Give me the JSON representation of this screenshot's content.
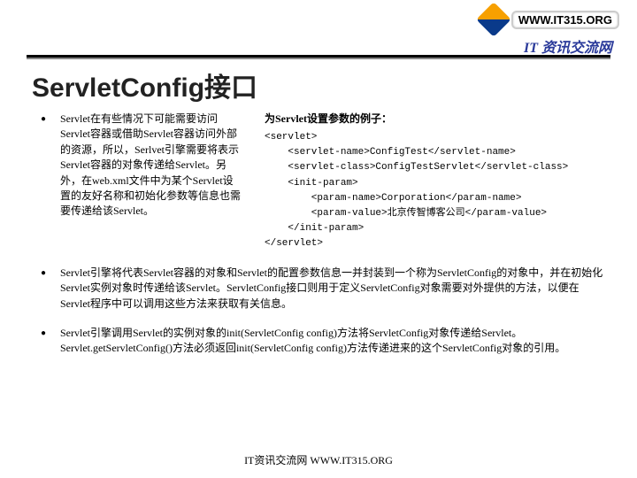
{
  "header": {
    "url": "WWW.IT315.ORG",
    "tagline": "IT 资讯交流网"
  },
  "title": "ServletConfig接口",
  "bullets": {
    "intro": "Servlet在有些情况下可能需要访问Servlet容器或借助Servlet容器访问外部的资源，所以，Serlvet引擎需要将表示Servlet容器的对象传递给Servlet。另外，在web.xml文件中为某个Servlet设置的友好名称和初始化参数等信息也需要传递给该Servlet。",
    "example_title": "为Servlet设置参数的例子：",
    "code": "<servlet>\n    <servlet-name>ConfigTest</servlet-name>\n    <servlet-class>ConfigTestServlet</servlet-class>\n    <init-param>\n        <param-name>Corporation</param-name>\n        <param-value>北京传智博客公司</param-value>\n    </init-param>\n</servlet>",
    "b2": "Servlet引擎将代表Servlet容器的对象和Servlet的配置参数信息一并封装到一个称为ServletConfig的对象中，并在初始化Servlet实例对象时传递给该Servlet。ServletConfig接口则用于定义ServletConfig对象需要对外提供的方法，以便在Servlet程序中可以调用这些方法来获取有关信息。",
    "b3": "Servlet引擎调用Servlet的实例对象的init(ServletConfig  config)方法将ServletConfig对象传递给Servlet。Servlet.getServletConfig()方法必须返回init(ServletConfig  config)方法传递进来的这个ServletConfig对象的引用。"
  },
  "footer": "IT资讯交流网 WWW.IT315.ORG"
}
